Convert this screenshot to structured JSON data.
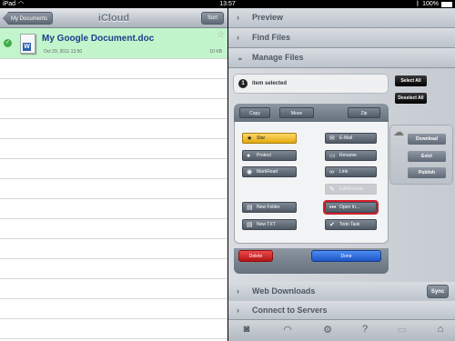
{
  "status": {
    "carrier": "iPad",
    "wifi_icon": "wifi-icon",
    "time": "13:57",
    "battery": "100%"
  },
  "left": {
    "back_label": "My Documents",
    "title": "iCloud",
    "sort_label": "Sort",
    "file": {
      "name": "My Google Document.doc",
      "date": "Oct 29, 2011 13:50",
      "size": "10 KB"
    }
  },
  "sections": {
    "preview": "Preview",
    "find_files": "Find Files",
    "manage_files": "Manage Files",
    "web_downloads": "Web Downloads",
    "connect": "Connect to Servers"
  },
  "manage": {
    "selected_count": "1",
    "selected_text": "item selected",
    "select_all": "Select All",
    "deselect_all": "Deselect All",
    "copy": "Copy",
    "move": "Move",
    "zip": "Zip",
    "star": "Star",
    "email": "E-Mail",
    "protect": "Protect",
    "rename": "Rename",
    "markread": "MarkRead",
    "link": "Link",
    "editforhtml": "Edit/Format",
    "new_folder": "New Folder",
    "open_in": "Open In...",
    "new_txt": "New TXT",
    "todo_task": "Todo Task",
    "delete": "Delete",
    "done": "Done"
  },
  "cloud": {
    "download": "Download",
    "evict": "Evict",
    "publish": "Publish"
  },
  "web_downloads_sync": "Sync",
  "colors": {
    "selected_row": "#c2f5cc",
    "delete": "#d42b2b",
    "done": "#2f6fe0",
    "star": "#f3c12f",
    "highlight": "#d41f2a"
  }
}
